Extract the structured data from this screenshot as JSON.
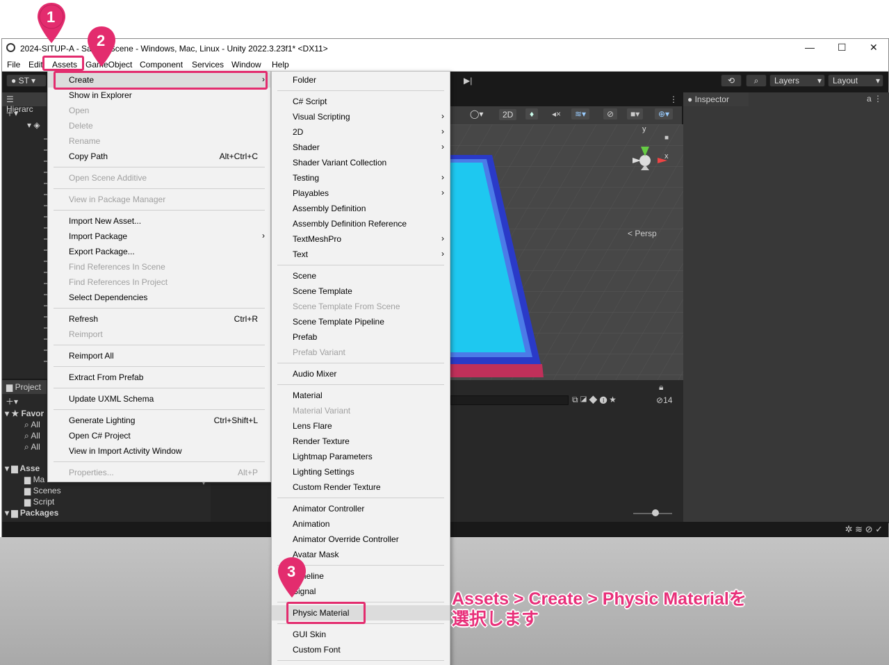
{
  "window": {
    "title": "2024-SITUP-A - SampleScene - Windows, Mac, Linux - Unity 2022.3.23f1* <DX11>",
    "controls": [
      "—",
      "☐",
      "✕"
    ]
  },
  "menubar": [
    "File",
    "Edit",
    "Assets",
    "GameObject",
    "Component",
    "Services",
    "Window",
    "Help"
  ],
  "toolbar": {
    "account": "ST",
    "layers": "Layers",
    "layout": "Layout"
  },
  "hierarchy": {
    "tab": "Hierarc"
  },
  "project": {
    "tab": "Project",
    "favorites": "Favor",
    "fav_items": [
      "All",
      "All",
      "All"
    ],
    "assets": "Asse",
    "asset_items": [
      "Ma",
      "Scenes",
      "Script"
    ],
    "packages": "Packages"
  },
  "scene_view": {
    "mode_2d": "2D",
    "persp": "Persp",
    "axis_y": "y",
    "axis_x": "x",
    "hidden_count": "14"
  },
  "inspector": {
    "tab": "Inspector"
  },
  "assets_menu": [
    {
      "label": "Create",
      "arrow": true,
      "highlight": true
    },
    {
      "label": "Show in Explorer"
    },
    {
      "label": "Open",
      "disabled": true
    },
    {
      "label": "Delete",
      "disabled": true
    },
    {
      "label": "Rename",
      "disabled": true
    },
    {
      "label": "Copy Path",
      "shortcut": "Alt+Ctrl+C"
    },
    {
      "sep": true
    },
    {
      "label": "Open Scene Additive",
      "disabled": true
    },
    {
      "sep": true
    },
    {
      "label": "View in Package Manager",
      "disabled": true
    },
    {
      "sep": true
    },
    {
      "label": "Import New Asset..."
    },
    {
      "label": "Import Package",
      "arrow": true
    },
    {
      "label": "Export Package..."
    },
    {
      "label": "Find References In Scene",
      "disabled": true
    },
    {
      "label": "Find References In Project",
      "disabled": true
    },
    {
      "label": "Select Dependencies"
    },
    {
      "sep": true
    },
    {
      "label": "Refresh",
      "shortcut": "Ctrl+R"
    },
    {
      "label": "Reimport",
      "disabled": true
    },
    {
      "sep": true
    },
    {
      "label": "Reimport All"
    },
    {
      "sep": true
    },
    {
      "label": "Extract From Prefab"
    },
    {
      "sep": true
    },
    {
      "label": "Update UXML Schema"
    },
    {
      "sep": true
    },
    {
      "label": "Generate Lighting",
      "shortcut": "Ctrl+Shift+L"
    },
    {
      "label": "Open C# Project"
    },
    {
      "label": "View in Import Activity Window"
    },
    {
      "sep": true
    },
    {
      "label": "Properties...",
      "shortcut": "Alt+P",
      "disabled": true
    }
  ],
  "create_menu": [
    {
      "label": "Folder"
    },
    {
      "sep": true
    },
    {
      "label": "C# Script"
    },
    {
      "label": "Visual Scripting",
      "arrow": true
    },
    {
      "label": "2D",
      "arrow": true
    },
    {
      "label": "Shader",
      "arrow": true
    },
    {
      "label": "Shader Variant Collection"
    },
    {
      "label": "Testing",
      "arrow": true
    },
    {
      "label": "Playables",
      "arrow": true
    },
    {
      "label": "Assembly Definition"
    },
    {
      "label": "Assembly Definition Reference"
    },
    {
      "label": "TextMeshPro",
      "arrow": true
    },
    {
      "label": "Text",
      "arrow": true
    },
    {
      "sep": true
    },
    {
      "label": "Scene"
    },
    {
      "label": "Scene Template"
    },
    {
      "label": "Scene Template From Scene",
      "disabled": true
    },
    {
      "label": "Scene Template Pipeline"
    },
    {
      "label": "Prefab"
    },
    {
      "label": "Prefab Variant",
      "disabled": true
    },
    {
      "sep": true
    },
    {
      "label": "Audio Mixer"
    },
    {
      "sep": true
    },
    {
      "label": "Material"
    },
    {
      "label": "Material Variant",
      "disabled": true
    },
    {
      "label": "Lens Flare"
    },
    {
      "label": "Render Texture"
    },
    {
      "label": "Lightmap Parameters"
    },
    {
      "label": "Lighting Settings"
    },
    {
      "label": "Custom Render Texture"
    },
    {
      "sep": true
    },
    {
      "label": "Animator Controller"
    },
    {
      "label": "Animation"
    },
    {
      "label": "Animator Override Controller"
    },
    {
      "label": "Avatar Mask"
    },
    {
      "sep": true
    },
    {
      "label": "Timeline"
    },
    {
      "label": "Signal"
    },
    {
      "sep": true
    },
    {
      "label": "Physic Material",
      "highlight": true
    },
    {
      "sep": true
    },
    {
      "label": "GUI Skin"
    },
    {
      "label": "Custom Font"
    },
    {
      "sep": true
    }
  ],
  "callouts": [
    "1",
    "2",
    "3"
  ],
  "annotation": {
    "line1": "Assets > Create > Physic Materialを",
    "line2": "選択します"
  },
  "colors": {
    "accent": "#e32c6e",
    "water": "#1ec8f0",
    "frame": "#3c6ee0"
  }
}
